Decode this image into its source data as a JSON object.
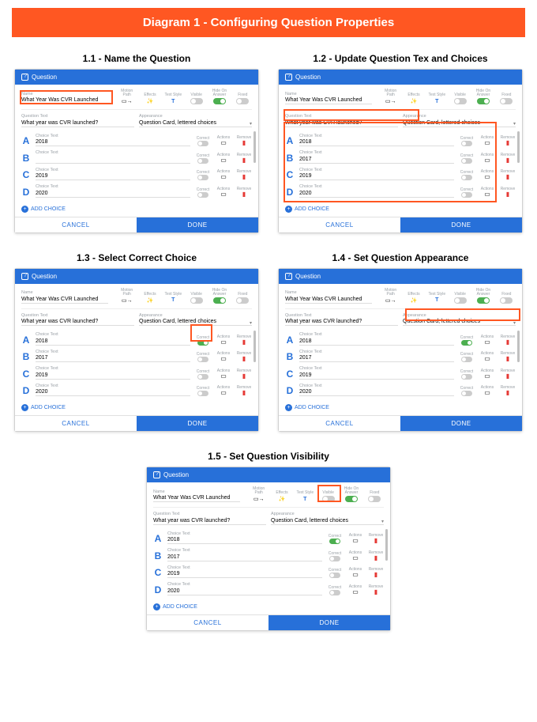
{
  "banner": "Diagram 1 - Configuring Question Properties",
  "captions": {
    "p1": "1.1 - Name the Question",
    "p2": "1.2 - Update Question Tex and Choices",
    "p3": "1.3 - Select Correct Choice",
    "p4": "1.4 - Set Question Appearance",
    "p5": "1.5 - Set Question Visibility"
  },
  "header": {
    "title": "Question"
  },
  "labels": {
    "name": "Name",
    "motionpath": "Motion Path",
    "effects": "Effects",
    "textstyle": "Text Style",
    "visible": "Visible",
    "hideonanswer": "Hide On Answer",
    "fixed": "Fixed",
    "questiontext": "Question Text",
    "appearance": "Appearance",
    "choicetext": "Choice Text",
    "correct": "Correct",
    "actions": "Actions",
    "remove": "Remove",
    "addchoice": "ADD CHOICE",
    "cancel": "CANCEL",
    "done": "DONE"
  },
  "values": {
    "name": "What Year Was CVR Launched",
    "questiontext": "What year was CVR launched?",
    "appearance": "Question Card, lettered choices"
  },
  "choices4": [
    {
      "letter": "A",
      "value": "2018"
    },
    {
      "letter": "B",
      "value": ""
    },
    {
      "letter": "C",
      "value": "2019"
    },
    {
      "letter": "D",
      "value": "2020"
    }
  ],
  "choices4filled": [
    {
      "letter": "A",
      "value": "2018"
    },
    {
      "letter": "B",
      "value": "2017"
    },
    {
      "letter": "C",
      "value": "2019"
    },
    {
      "letter": "D",
      "value": "2020"
    }
  ],
  "icons": {
    "motionpath": "▭→",
    "effects": "✨",
    "textstyle": "T",
    "actions": "⚙",
    "trash": "⌫"
  }
}
